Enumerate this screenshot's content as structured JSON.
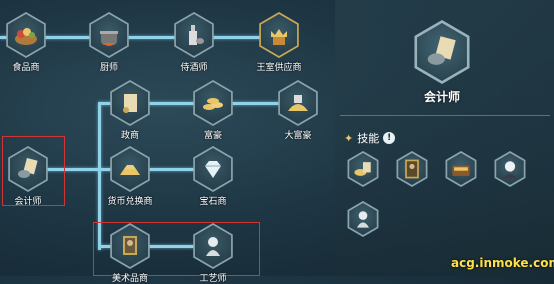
{
  "tree": {
    "nodes": {
      "food_merchant": {
        "label": "食品商",
        "icon": "food-basket-icon"
      },
      "chef": {
        "label": "厨师",
        "icon": "cooking-pot-icon"
      },
      "sommelier": {
        "label": "侍酒师",
        "icon": "wine-bottle-icon"
      },
      "royal_supplier": {
        "label": "王室供应商",
        "icon": "crown-crest-icon"
      },
      "politician": {
        "label": "政商",
        "icon": "scroll-icon"
      },
      "rich": {
        "label": "富豪",
        "icon": "gold-coins-icon"
      },
      "tycoon": {
        "label": "大富豪",
        "icon": "gold-pile-icon"
      },
      "accountant": {
        "label": "会计师",
        "icon": "ledger-coins-icon"
      },
      "currency_exchanger": {
        "label": "货币兑换商",
        "icon": "gold-bars-icon"
      },
      "jeweler": {
        "label": "宝石商",
        "icon": "diamond-icon"
      },
      "art_dealer": {
        "label": "美术品商",
        "icon": "painting-icon"
      },
      "craftsman": {
        "label": "工艺师",
        "icon": "bust-statue-icon"
      }
    }
  },
  "panel": {
    "title": "会计师",
    "icon": "ledger-coins-icon",
    "skills_label": "技能",
    "info_symbol": "!",
    "skills": [
      {
        "icon": "coins-scroll-icon"
      },
      {
        "icon": "mona-lisa-icon"
      },
      {
        "icon": "treasure-box-icon"
      },
      {
        "icon": "composer-portrait-icon"
      },
      {
        "icon": "bust-statue-icon"
      }
    ]
  },
  "watermark": "acg.inmoke.com",
  "colors": {
    "line": "#8fd3ea",
    "highlight_box": "#d23434",
    "gold": "#e8c66a"
  }
}
